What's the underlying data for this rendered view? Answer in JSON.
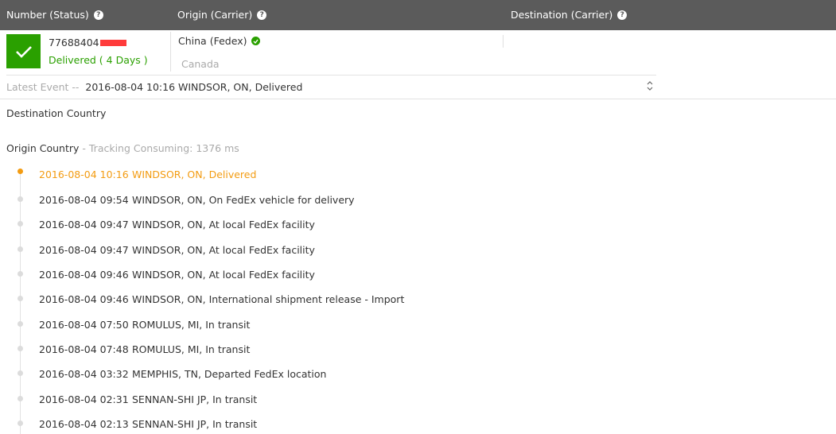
{
  "header": {
    "col_number": "Number (Status)",
    "col_origin": "Origin (Carrier)",
    "col_destination": "Destination (Carrier)",
    "help_glyph": "?"
  },
  "shipment": {
    "tracking_number_visible": "77688404",
    "status": "Delivered ( 4 Days )",
    "origin": "China",
    "carrier": "(Fedex)",
    "destination_country": "Canada",
    "status_color": "#2aa000"
  },
  "latest_event": {
    "label": "Latest Event --",
    "text": "2016-08-04 10:16 WINDSOR, ON, Delivered",
    "expand_glyph": "⌄⌃"
  },
  "sections": {
    "destination_title": "Destination Country",
    "origin_title": "Origin Country",
    "consuming": " - Tracking Consuming: 1376 ms"
  },
  "events": [
    {
      "time": "2016-08-04 10:16",
      "desc": "WINDSOR, ON, Delivered"
    },
    {
      "time": "2016-08-04 09:54",
      "desc": "WINDSOR, ON, On FedEx vehicle for delivery"
    },
    {
      "time": "2016-08-04 09:47",
      "desc": "WINDSOR, ON, At local FedEx facility"
    },
    {
      "time": "2016-08-04 09:47",
      "desc": "WINDSOR, ON, At local FedEx facility"
    },
    {
      "time": "2016-08-04 09:46",
      "desc": "WINDSOR, ON, At local FedEx facility"
    },
    {
      "time": "2016-08-04 09:46",
      "desc": "WINDSOR, ON, International shipment release - Import"
    },
    {
      "time": "2016-08-04 07:50",
      "desc": "ROMULUS, MI, In transit"
    },
    {
      "time": "2016-08-04 07:48",
      "desc": "ROMULUS, MI, In transit"
    },
    {
      "time": "2016-08-04 03:32",
      "desc": "MEMPHIS, TN, Departed FedEx location"
    },
    {
      "time": "2016-08-04 02:31",
      "desc": "SENNAN-SHI JP, In transit"
    },
    {
      "time": "2016-08-04 02:13",
      "desc": "SENNAN-SHI JP, In transit"
    }
  ],
  "colors": {
    "header_bg": "#5b5b5b",
    "active_event": "#f39c12",
    "delivered": "#2aa000"
  }
}
